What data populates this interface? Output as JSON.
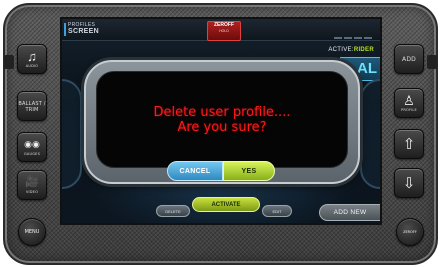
{
  "screen": {
    "title_small": "PROFILES",
    "title_large": "SCREEN",
    "zero_off": {
      "label": "ZEROFF",
      "sub": "HOLD"
    },
    "rider_prefix": "ACTIVE:",
    "rider_name": "RIDER",
    "rider_box_text": "AL"
  },
  "dialog": {
    "line1": "Delete user profile....",
    "line2": "Are you sure?",
    "cancel_label": "CANCEL",
    "yes_label": "YES"
  },
  "bottom": {
    "activate_label": "ACTIVATE",
    "delete_label": "DELETE",
    "edit_label": "EDIT",
    "add_new_label": "ADD NEW"
  },
  "hardware": {
    "left": [
      {
        "icon": "music-note-icon",
        "glyph": "♫",
        "label": "AUDIO"
      },
      {
        "icon": "ballast-icon",
        "glyph": "",
        "label": "BALLAST / TRIM"
      },
      {
        "icon": "gauges-icon",
        "glyph": "◉◉",
        "label": "GAUGES"
      },
      {
        "icon": "video-camera-icon",
        "glyph": "🎥",
        "label": "VIDEO"
      }
    ],
    "right": [
      {
        "icon": "add-icon",
        "glyph": "ADD",
        "label": ""
      },
      {
        "icon": "profile-icon",
        "glyph": "♙",
        "label": "PROFILE"
      },
      {
        "icon": "arrow-up-icon",
        "glyph": "⇧",
        "label": ""
      },
      {
        "icon": "arrow-down-icon",
        "glyph": "⇩",
        "label": ""
      }
    ],
    "menu_label": "MENU",
    "zero_off_label": "ZEROFF"
  },
  "colors": {
    "dialog_text": "#ff1a1a",
    "cancel": "#3b97cc",
    "yes": "#a8cc2a",
    "accent": "#3aa0e0"
  }
}
